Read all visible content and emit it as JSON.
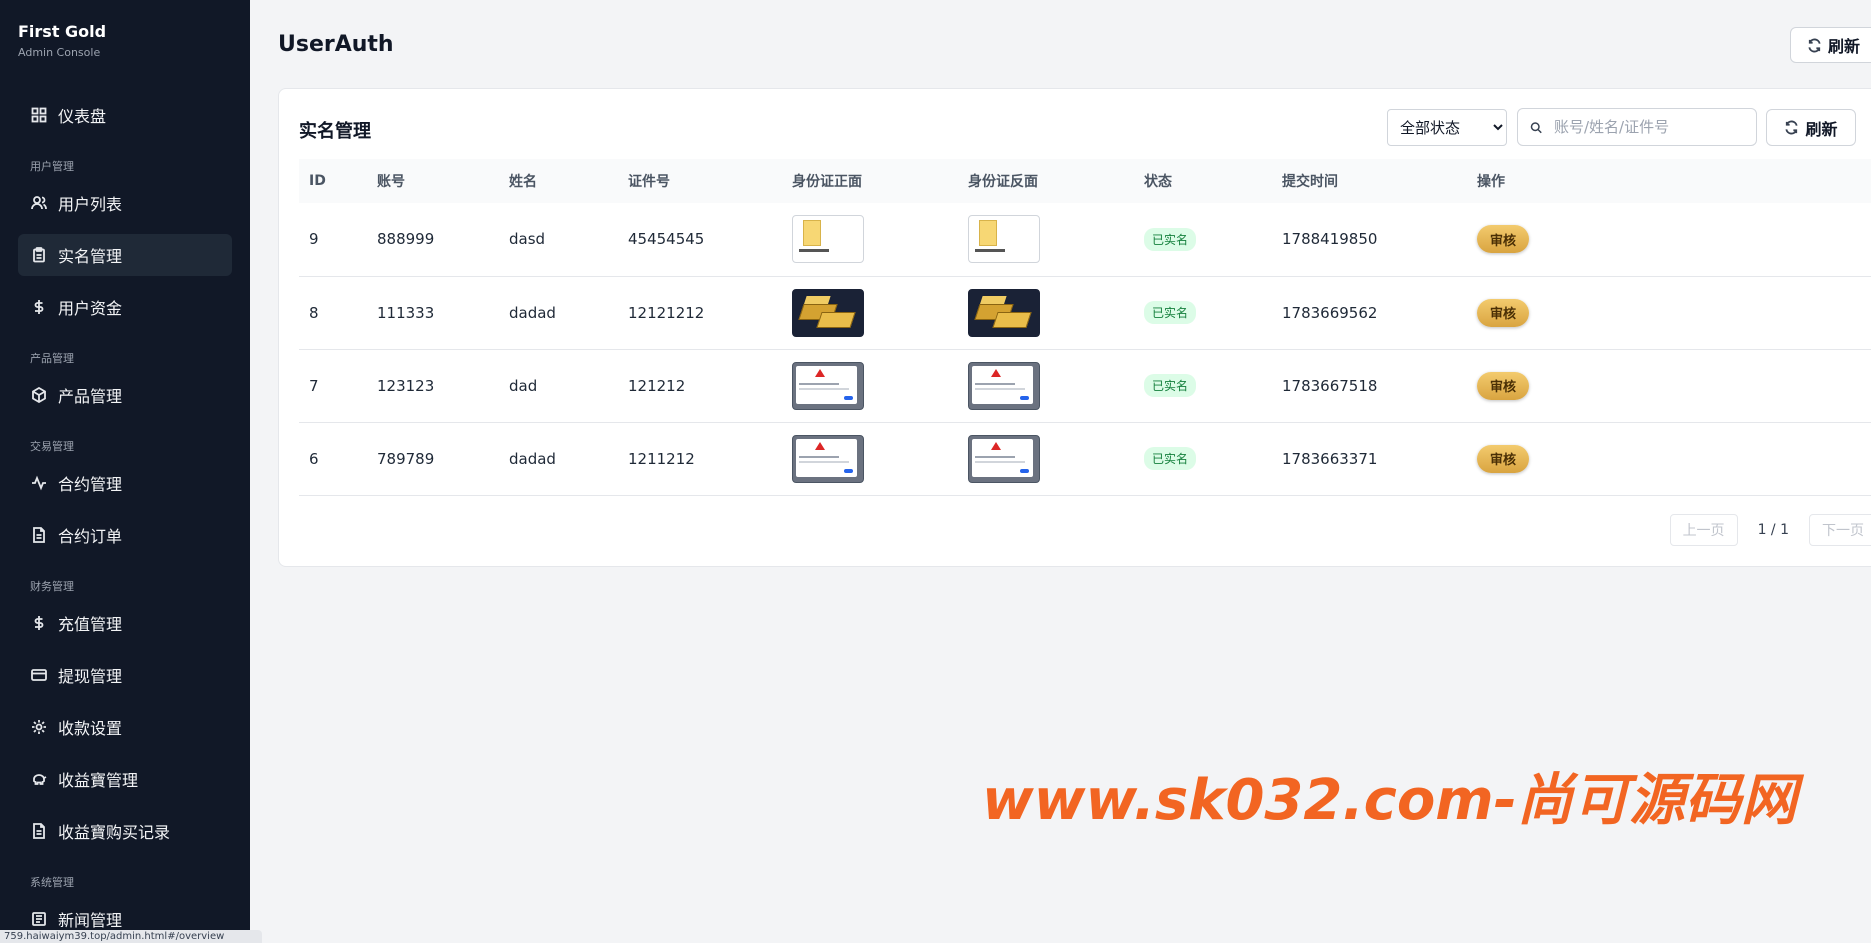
{
  "brand": {
    "title": "First Gold",
    "subtitle": "Admin Console"
  },
  "sidebar": {
    "dashboard": "仪表盘",
    "groups": {
      "user": "用户管理",
      "product": "产品管理",
      "trade": "交易管理",
      "finance": "财务管理",
      "system": "系统管理"
    },
    "items": {
      "user_list": "用户列表",
      "realname": "实名管理",
      "user_funds": "用户资金",
      "products": "产品管理",
      "contracts": "合约管理",
      "contract_orders": "合约订单",
      "recharge": "充值管理",
      "withdraw": "提现管理",
      "payment_settings": "收款设置",
      "yield_mgmt": "收益寶管理",
      "yield_records": "收益寶购买记录",
      "news": "新闻管理"
    },
    "status_url": "759.haiwaiym39.top/admin.html#/overview"
  },
  "header": {
    "title": "UserAuth",
    "refresh_label": "刷新"
  },
  "card": {
    "title": "实名管理",
    "status_filter": {
      "selected": "全部状态"
    },
    "search": {
      "placeholder": "账号/姓名/证件号"
    },
    "refresh_label": "刷新"
  },
  "table": {
    "columns": [
      "ID",
      "账号",
      "姓名",
      "证件号",
      "身份证正面",
      "身份证反面",
      "状态",
      "提交时间",
      "操作"
    ],
    "rows": [
      {
        "id": "9",
        "account": "888999",
        "name": "dasd",
        "id_number": "45454545",
        "front": "folder-image",
        "back": "folder-image",
        "status": "已实名",
        "time": "1788419850",
        "action": "审核"
      },
      {
        "id": "8",
        "account": "111333",
        "name": "dadad",
        "id_number": "12121212",
        "front": "gold-bars-image",
        "back": "gold-bars-image",
        "status": "已实名",
        "time": "1783669562",
        "action": "审核"
      },
      {
        "id": "7",
        "account": "123123",
        "name": "dad",
        "id_number": "121212",
        "front": "screenshot-image",
        "back": "screenshot-image",
        "status": "已实名",
        "time": "1783667518",
        "action": "审核"
      },
      {
        "id": "6",
        "account": "789789",
        "name": "dadad",
        "id_number": "1211212",
        "front": "screenshot-image",
        "back": "screenshot-image",
        "status": "已实名",
        "time": "1783663371",
        "action": "审核"
      }
    ]
  },
  "pagination": {
    "prev": "上一页",
    "info": "1 / 1",
    "next": "下一页"
  },
  "watermark": "www.sk032.com-尚可源码网",
  "colors": {
    "sidebar_bg": "#111827",
    "badge_green": "#15803d",
    "review_gold": "#d9a440",
    "watermark": "#f26522"
  }
}
